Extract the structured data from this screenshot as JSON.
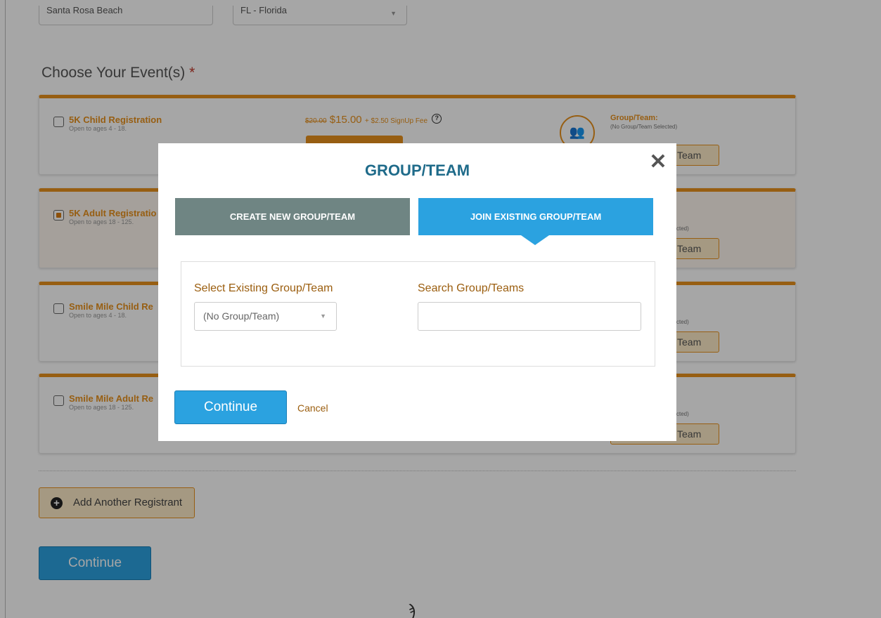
{
  "form": {
    "city_value": "Santa Rosa Beach",
    "state_value": "FL - Florida",
    "section_title": "Choose Your Event(s)",
    "required_mark": "*"
  },
  "events": [
    {
      "name": "5K Child Registration",
      "age": "Open to ages 4 - 18.",
      "old_price": "$20.00",
      "price": "$15.00",
      "fee": "+ $2.50 SignUp Fee",
      "group_label": "Group/Team:",
      "group_value": "(No Group/Team Selected)",
      "group_btn": "Team",
      "checked": false
    },
    {
      "name": "5K Adult Registratio",
      "age": "Open to ages 18 - 125.",
      "group_value": "cted)",
      "group_btn": "Team",
      "checked": true
    },
    {
      "name": "Smile Mile Child Re",
      "age": "Open to ages 4 - 18.",
      "group_value": "cted)",
      "group_btn": "Team",
      "checked": false
    },
    {
      "name": "Smile Mile Adult Re",
      "age": "Open to ages 18 - 125.",
      "group_value": "cted)",
      "group_btn": "Team",
      "checked": false
    }
  ],
  "footer": {
    "add_label": "Add Another Registrant",
    "continue_label": "Continue"
  },
  "modal": {
    "title": "GROUP/TEAM",
    "close_glyph": "✕",
    "tabs": [
      {
        "label": "CREATE NEW GROUP/TEAM",
        "active": false
      },
      {
        "label": "JOIN EXISTING GROUP/TEAM",
        "active": true
      }
    ],
    "select_label": "Select Existing Group/Team",
    "select_value": "(No Group/Team)",
    "search_label": "Search Group/Teams",
    "search_value": "",
    "continue_label": "Continue",
    "cancel_label": "Cancel"
  },
  "colors": {
    "accent_orange": "#e8911c",
    "primary_blue": "#2ba2e0",
    "title_blue": "#1f6b8a",
    "label_brown": "#9b5e0f",
    "tab_gray": "#6f8583"
  }
}
